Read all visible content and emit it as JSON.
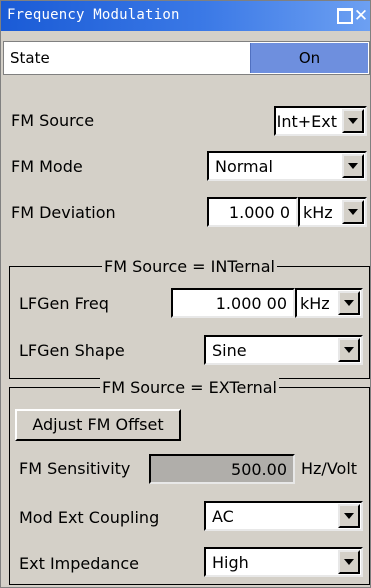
{
  "window": {
    "title": "Frequency Modulation"
  },
  "state": {
    "label": "State",
    "value": "On"
  },
  "fm_source": {
    "label": "FM Source",
    "value": "Int+Ext"
  },
  "fm_mode": {
    "label": "FM Mode",
    "value": "Normal"
  },
  "fm_deviation": {
    "label": "FM Deviation",
    "value": "1.000 0",
    "unit": "kHz"
  },
  "internal_group": {
    "title": "FM Source = INTernal",
    "lfgen_freq": {
      "label": "LFGen Freq",
      "value": "1.000 00",
      "unit": "kHz"
    },
    "lfgen_shape": {
      "label": "LFGen Shape",
      "value": "Sine"
    }
  },
  "external_group": {
    "title": "FM Source = EXTernal",
    "adjust_button": "Adjust FM Offset",
    "sensitivity": {
      "label": "FM Sensitivity",
      "value": "500.00",
      "unit": "Hz/Volt"
    },
    "coupling": {
      "label": "Mod Ext Coupling",
      "value": "AC"
    },
    "impedance": {
      "label": "Ext Impedance",
      "value": "High"
    }
  }
}
